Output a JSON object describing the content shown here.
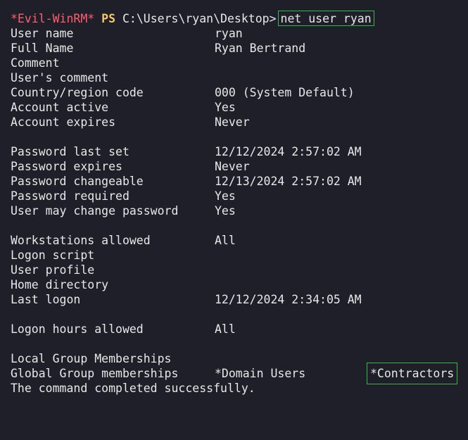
{
  "prompt": {
    "host": "*Evil-WinRM*",
    "shell": "PS",
    "path": "C:\\Users\\ryan\\Desktop>",
    "command": "net user ryan"
  },
  "rows": [
    {
      "label": "User name",
      "value": "ryan"
    },
    {
      "label": "Full Name",
      "value": "Ryan Bertrand"
    },
    {
      "label": "Comment",
      "value": ""
    },
    {
      "label": "User's comment",
      "value": ""
    },
    {
      "label": "Country/region code",
      "value": "000 (System Default)"
    },
    {
      "label": "Account active",
      "value": "Yes"
    },
    {
      "label": "Account expires",
      "value": "Never"
    },
    {
      "label": "Password last set",
      "value": "12/12/2024 2:57:02 AM"
    },
    {
      "label": "Password expires",
      "value": "Never"
    },
    {
      "label": "Password changeable",
      "value": "12/13/2024 2:57:02 AM"
    },
    {
      "label": "Password required",
      "value": "Yes"
    },
    {
      "label": "User may change password",
      "value": "Yes"
    },
    {
      "label": "Workstations allowed",
      "value": "All"
    },
    {
      "label": "Logon script",
      "value": ""
    },
    {
      "label": "User profile",
      "value": ""
    },
    {
      "label": "Home directory",
      "value": ""
    },
    {
      "label": "Last logon",
      "value": "12/12/2024 2:34:05 AM"
    },
    {
      "label": "Logon hours allowed",
      "value": "All"
    },
    {
      "label": "Local Group Memberships",
      "value": ""
    },
    {
      "label": "Global Group memberships",
      "value": "*Domain Users",
      "value2": "*Contractors"
    }
  ],
  "footer": "The command completed successfully.",
  "colors": {
    "background": "#1e1f29",
    "text": "#e8e8e8",
    "host": "#ff5f6d",
    "ps": "#f4c96a",
    "highlight_box": "#3bb54a"
  }
}
